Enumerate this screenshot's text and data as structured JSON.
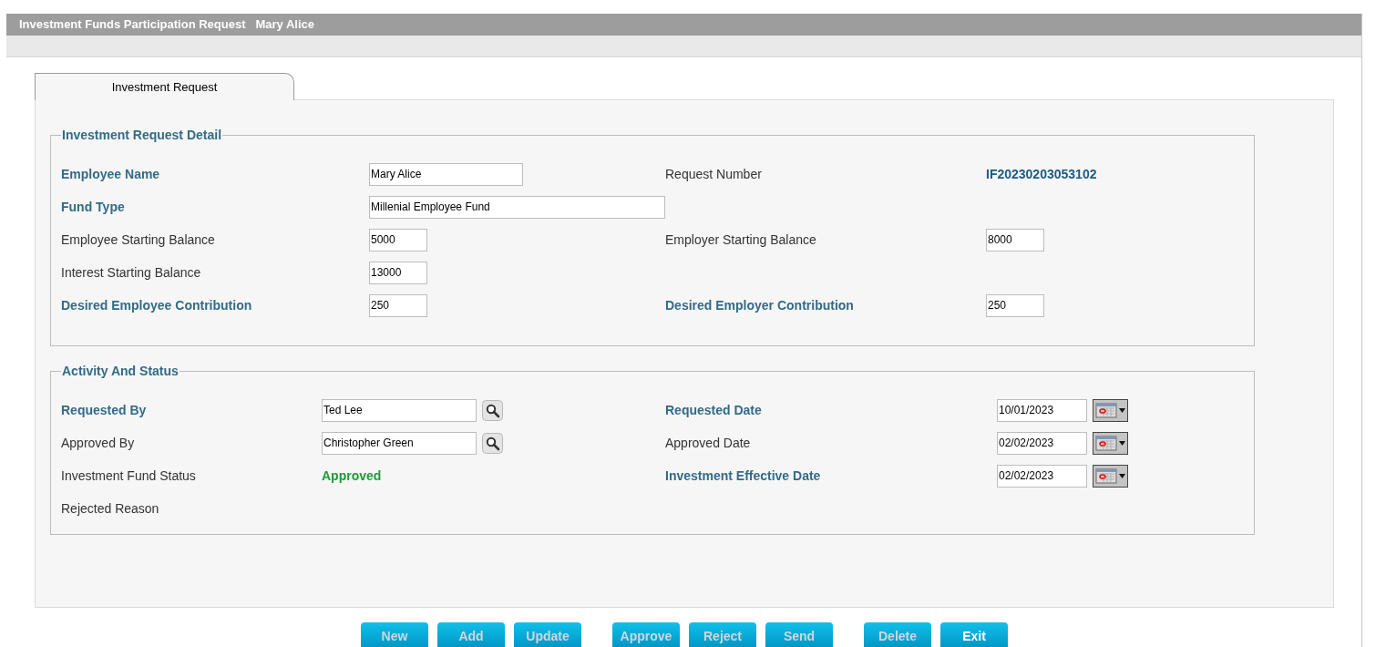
{
  "window": {
    "title": "Investment Funds Participation Request",
    "subject": "Mary Alice"
  },
  "tabs": [
    {
      "label": "Investment Request",
      "selected": true
    }
  ],
  "sections": [
    {
      "title": "Investment Request Detail",
      "rows": [
        [
          {
            "label": "Employee Name",
            "required": true,
            "kind": "name",
            "value": "Mary Alice"
          },
          {
            "label": "Request Number",
            "required": false,
            "kind": "id",
            "value": "IF20230203053102"
          }
        ],
        [
          {
            "label": "Fund Type",
            "required": true,
            "kind": "wide",
            "value": "Millenial Employee Fund"
          }
        ],
        [
          {
            "label": "Employee Starting Balance",
            "required": false,
            "kind": "number",
            "value": "5000"
          },
          {
            "label": "Employer Starting Balance",
            "required": false,
            "kind": "number",
            "value": "8000"
          }
        ],
        [
          {
            "label": "Interest Starting Balance",
            "required": false,
            "kind": "number",
            "value": "13000"
          }
        ],
        [
          {
            "label": "Desired Employee Contribution",
            "required": true,
            "kind": "number",
            "value": "250"
          },
          {
            "label": "Desired Employer Contribution",
            "required": true,
            "kind": "number",
            "value": "250"
          }
        ]
      ]
    },
    {
      "title": "Activity And Status",
      "rows": [
        [
          {
            "label": "Requested By",
            "required": true,
            "kind": "lookup",
            "value": "Ted Lee"
          },
          {
            "label": "Requested Date",
            "required": true,
            "kind": "date",
            "value": "10/01/2023"
          }
        ],
        [
          {
            "label": "Approved By",
            "required": false,
            "kind": "lookup",
            "value": "Christopher Green"
          },
          {
            "label": "Approved Date",
            "required": false,
            "kind": "date",
            "value": "02/02/2023"
          }
        ],
        [
          {
            "label": "Investment Fund Status",
            "required": false,
            "kind": "status",
            "value": "Approved"
          },
          {
            "label": "Investment Effective Date",
            "required": true,
            "kind": "date",
            "value": "02/02/2023"
          }
        ],
        [
          {
            "label": "Rejected Reason",
            "required": false,
            "kind": "empty"
          }
        ]
      ]
    }
  ],
  "button_groups": [
    [
      {
        "label": "New",
        "disabled": true
      },
      {
        "label": "Add",
        "disabled": true
      },
      {
        "label": "Update",
        "disabled": true
      }
    ],
    [
      {
        "label": "Approve",
        "disabled": true
      },
      {
        "label": "Reject",
        "disabled": true
      },
      {
        "label": "Send",
        "disabled": true
      }
    ],
    [
      {
        "label": "Delete",
        "disabled": true
      },
      {
        "label": "Exit",
        "disabled": false
      }
    ]
  ]
}
